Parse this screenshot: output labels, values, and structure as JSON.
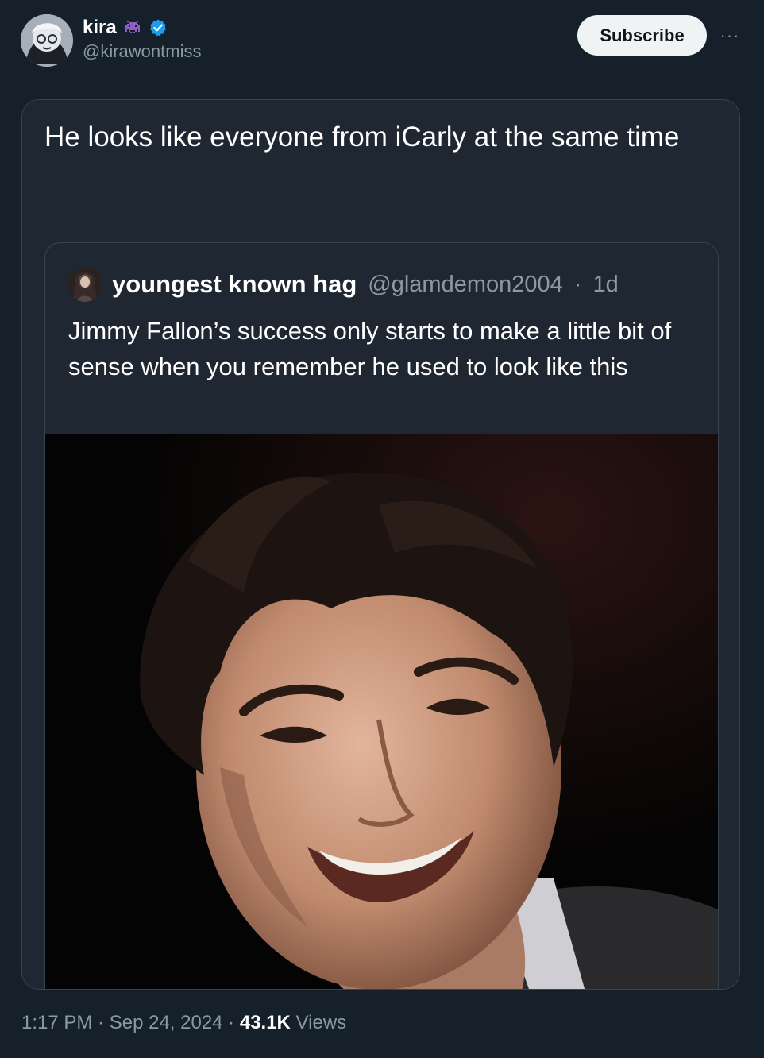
{
  "author": {
    "display_name": "kira",
    "handle": "@kirawontmiss",
    "icons": [
      "space-invader-emoji-icon",
      "verified-badge-icon"
    ]
  },
  "actions": {
    "subscribe_label": "Subscribe",
    "more_label": "···"
  },
  "post": {
    "text": "He looks like everyone from iCarly at the same time"
  },
  "quoted_post": {
    "display_name": "youngest known hag",
    "handle": "@glamdemon2004",
    "separator": "·",
    "age": "1d",
    "text": "Jimmy Fallon’s success only starts to make a little bit of sense when you remember he used to look like this"
  },
  "meta": {
    "time": "1:17 PM",
    "date": "Sep 24, 2024",
    "separator": " · ",
    "views_count": "43.1K",
    "views_label": " Views"
  },
  "colors": {
    "background": "#15202b",
    "card": "#1e2732",
    "border": "#38444d",
    "muted_text": "#8b98a5",
    "verified": "#1d9bf0",
    "invader": "#8b5fbf"
  }
}
